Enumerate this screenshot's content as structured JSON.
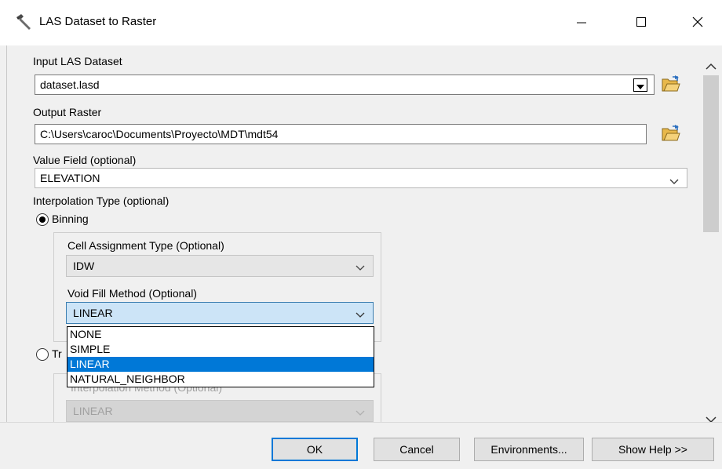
{
  "window": {
    "title": "LAS Dataset to Raster",
    "icon": "hammer-icon",
    "controls": [
      "minimize-icon",
      "maximize-icon",
      "close-icon"
    ]
  },
  "input_las": {
    "label": "Input LAS Dataset",
    "value": "dataset.lasd"
  },
  "output_raster": {
    "label": "Output Raster",
    "value": "C:\\Users\\caroc\\Documents\\Proyecto\\MDT\\mdt54"
  },
  "value_field": {
    "label": "Value Field (optional)",
    "value": "ELEVATION"
  },
  "interpolation": {
    "label": "Interpolation Type (optional)",
    "binning_label": "Binning",
    "triangulation_label_visible": "Tr",
    "selected": "Binning"
  },
  "binning": {
    "cell_assignment_label": "Cell Assignment Type (Optional)",
    "cell_assignment_value": "IDW",
    "void_fill_label": "Void Fill Method (Optional)",
    "void_fill_value": "LINEAR",
    "void_fill_options": [
      "NONE",
      "SIMPLE",
      "LINEAR",
      "NATURAL_NEIGHBOR"
    ],
    "void_fill_selected": "LINEAR"
  },
  "triangulation": {
    "interp_method_label": "Interpolation Method (Optional)",
    "interp_method_value": "LINEAR"
  },
  "buttons": {
    "ok": "OK",
    "cancel": "Cancel",
    "environments": "Environments...",
    "show_help": "Show Help >>"
  },
  "colors": {
    "selection": "#0078d7",
    "active_combo": "#cce4f7",
    "dialog_bg": "#f0f0f0"
  }
}
